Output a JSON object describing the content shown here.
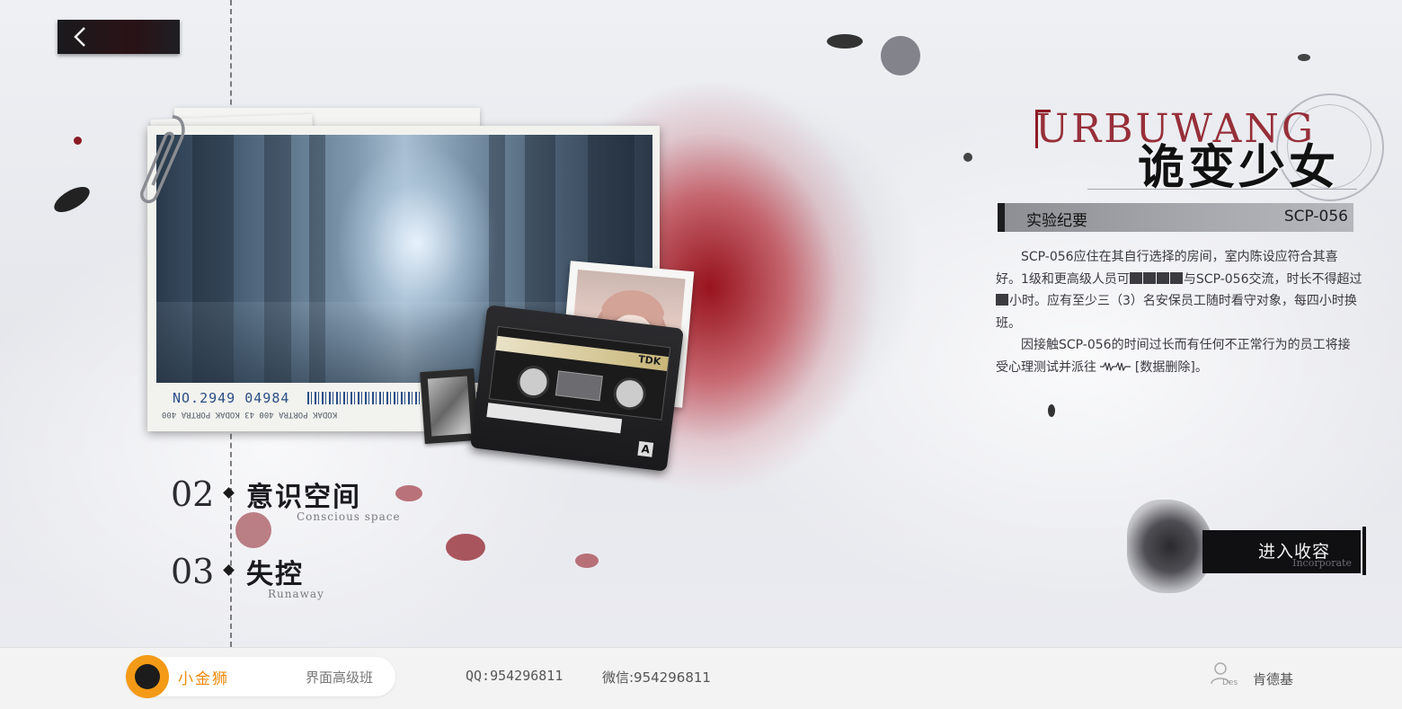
{
  "nav": {
    "back_icon": "chevron-left-icon"
  },
  "photo": {
    "code": "NO.2949 04984",
    "film_text": "KODAK PORTRA 400        43        KODAK PORTRA 400"
  },
  "cassette": {
    "brand": "TDK",
    "side": "A"
  },
  "chapters": [
    {
      "num": "02",
      "title": "意识空间",
      "subtitle": "Conscious space"
    },
    {
      "num": "03",
      "title": "失控",
      "subtitle": "Runaway"
    }
  ],
  "logo": {
    "en": "URBUWANG",
    "cn": "诡变少女"
  },
  "record": {
    "title": "实验纪要",
    "code": "SCP-056",
    "p1_a": "SCP-056应住在其自行选择的房间，室内陈设应符合其喜好。1级和更高级人员可",
    "p1_b": "与SCP-056交流，时长不得超过",
    "p1_c": "小时。应有至少三（3）名安保员工随时看守对象，每四小时换班。",
    "p2_a": "因接触SCP-056的时间过长而有任何不正常行为的员工将接受心理测试并派往",
    "p2_b": "[数据删除]。"
  },
  "enter": {
    "label": "进入收容",
    "sub": "Incorporate"
  },
  "footer": {
    "brand": "小金狮",
    "course": "界面高级班",
    "qq": "QQ:954296811",
    "wechat": "微信:954296811",
    "user_des": "Des",
    "user_name": "肯德基"
  },
  "colors": {
    "accent_red": "#8e1b26",
    "brand_orange": "#f08a0c"
  }
}
